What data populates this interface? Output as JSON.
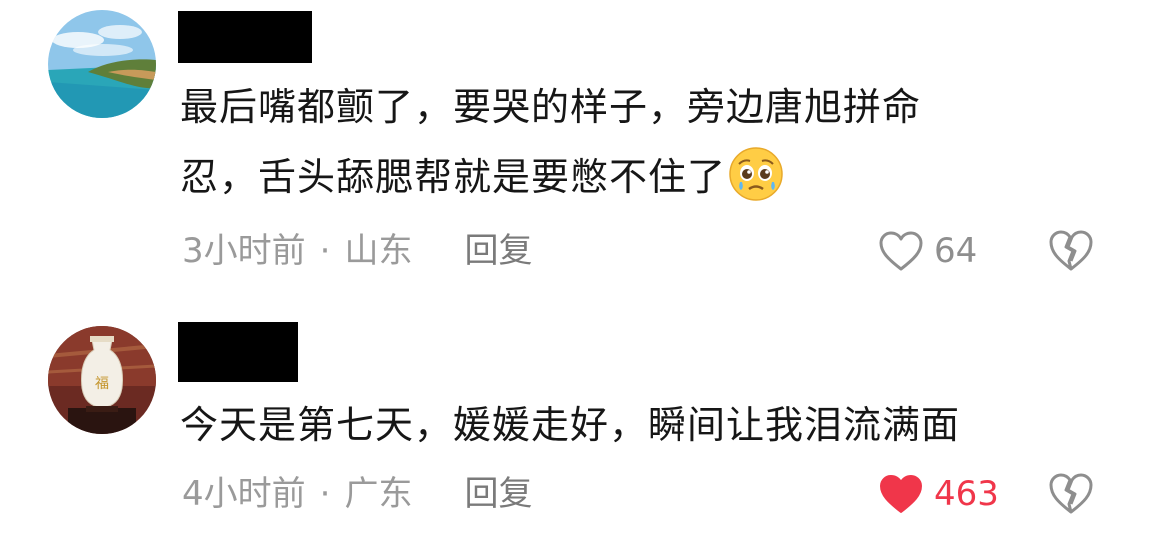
{
  "comments": [
    {
      "line1": "最后嘴都颤了，要哭的样子，旁边唐旭拼命",
      "line2": "忍，舌头舔腮帮就是要憋不住了",
      "emoji": "pleading-face-icon",
      "time": "3小时前",
      "separator": "·",
      "location": "山东",
      "reply": "回复",
      "likes": "64",
      "liked": false
    },
    {
      "line1": "今天是第七天，媛媛走好，瞬间让我泪流满面",
      "time": "4小时前",
      "separator": "·",
      "location": "广东",
      "reply": "回复",
      "likes": "463",
      "liked": true
    }
  ],
  "colors": {
    "liked_heart": "#f0364a",
    "meta_text": "#9a9a9a",
    "body_text": "#161616"
  }
}
